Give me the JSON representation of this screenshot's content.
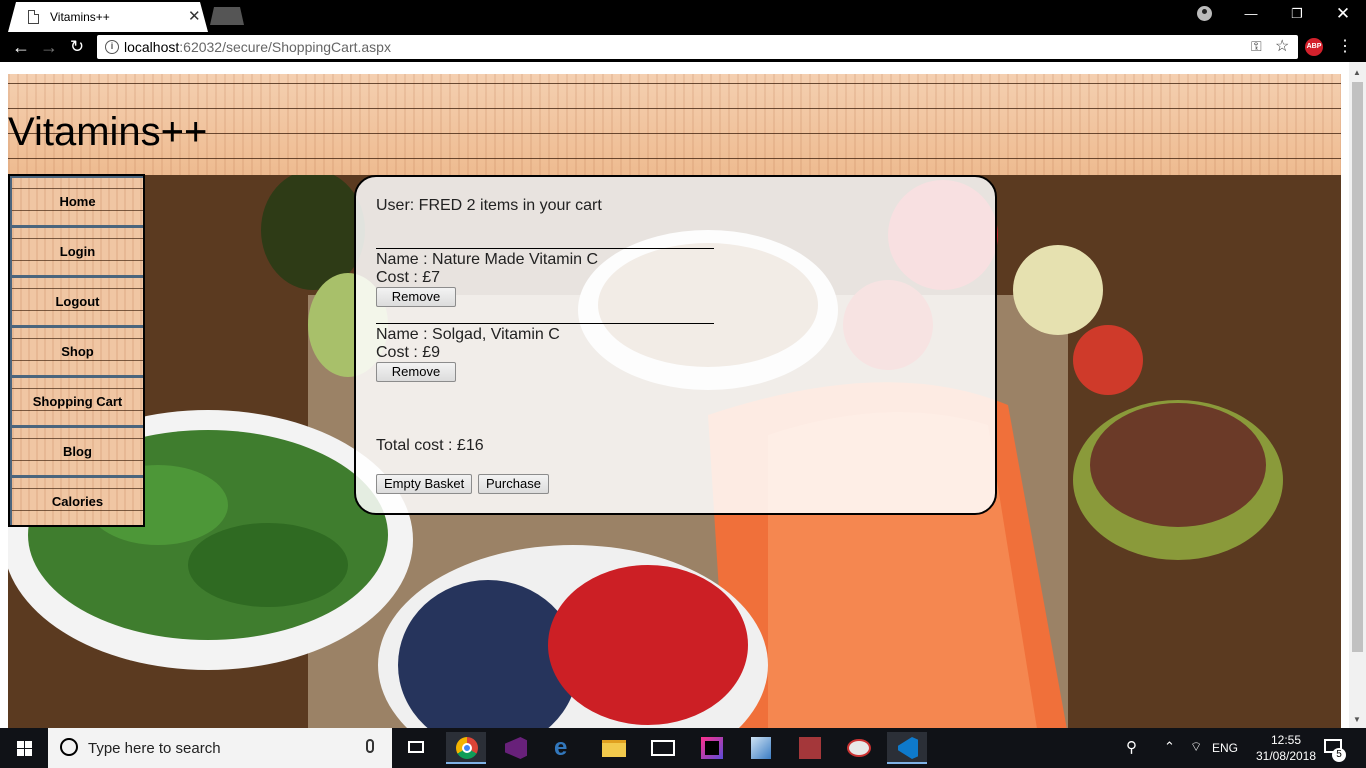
{
  "browser": {
    "tab_title": "Vitamins++",
    "url_host": "localhost",
    "url_rest": ":62032/secure/ShoppingCart.aspx"
  },
  "site": {
    "title": "Vitamins++"
  },
  "nav": {
    "items": [
      {
        "label": "Home"
      },
      {
        "label": "Login"
      },
      {
        "label": "Logout"
      },
      {
        "label": "Shop"
      },
      {
        "label": "Shopping Cart"
      },
      {
        "label": "Blog"
      },
      {
        "label": "Calories"
      }
    ]
  },
  "cart": {
    "user_line": "User: FRED 2 items in your cart",
    "items": [
      {
        "name": "Name : Nature Made Vitamin C",
        "cost": "Cost : £7",
        "remove_label": "Remove"
      },
      {
        "name": "Name : Solgad, Vitamin C",
        "cost": "Cost : £9",
        "remove_label": "Remove"
      }
    ],
    "total": "Total cost : £16",
    "empty_label": "Empty Basket",
    "purchase_label": "Purchase"
  },
  "taskbar": {
    "search_placeholder": "Type here to search",
    "language": "ENG",
    "time": "12:55",
    "date": "31/08/2018",
    "notifications": "5"
  },
  "icons": {
    "tab": "page-icon",
    "address": "info-icon",
    "key": "key-icon",
    "star": "star-icon",
    "extension": "adblock-plus-icon"
  },
  "colors": {
    "panel_border": "#000000",
    "nav_border": "#4b657d",
    "taskbar": "#101217"
  }
}
